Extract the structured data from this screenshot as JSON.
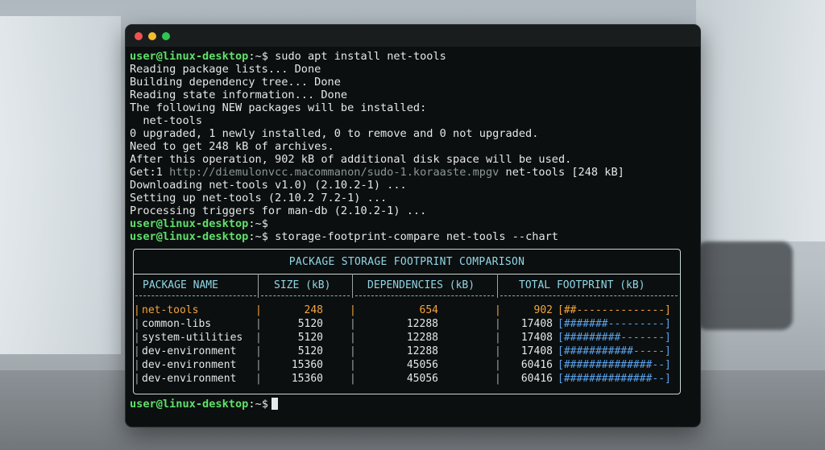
{
  "terminal": {
    "prompt": "user@linux-desktop",
    "path": ":~$",
    "lines": [
      {
        "type": "cmd",
        "text": " sudo apt install net-tools"
      },
      {
        "type": "out",
        "text": "Reading package lists... Done"
      },
      {
        "type": "out",
        "text": "Building dependency tree... Done"
      },
      {
        "type": "out",
        "text": "Reading state information... Done"
      },
      {
        "type": "out",
        "text": "The following NEW packages will be installed:"
      },
      {
        "type": "out",
        "text": "  net-tools"
      },
      {
        "type": "out",
        "text": "0 upgraded, 1 newly installed, 0 to remove and 0 not upgraded."
      },
      {
        "type": "out",
        "text": "Need to get 248 kB of archives."
      },
      {
        "type": "out",
        "text": "After this operation, 902 kB of additional disk space will be used."
      },
      {
        "type": "get",
        "prefix": "Get:1 ",
        "url": "http://diemulonvcc.macommanon/sudo-1.koraaste.mpgv",
        "suffix": " net-tools [248 kB]"
      },
      {
        "type": "out",
        "text": "Downloading net-tools v1.0) (2.10.2-1) ..."
      },
      {
        "type": "out",
        "text": "Setting up net-tools (2.10.2 7.2-1) ..."
      },
      {
        "type": "out",
        "text": "Processing triggers for man-db (2.10.2-1) ..."
      },
      {
        "type": "cmd",
        "text": ""
      },
      {
        "type": "cmd",
        "text": " storage-footprint-compare net-tools --chart"
      }
    ]
  },
  "chart_data": {
    "type": "table",
    "title": "PACKAGE STORAGE FOOTPRINT COMPARISON",
    "columns": [
      "PACKAGE NAME",
      "SIZE (kB)",
      "DEPENDENCIES (kB)",
      "TOTAL FOOTPRINT (kB)"
    ],
    "rows": [
      {
        "name": "net-tools",
        "size": "248",
        "deps": "654",
        "total": "902",
        "bar": "[##--------------]",
        "highlight": true
      },
      {
        "name": "common-libs",
        "size": "5120",
        "deps": "12288",
        "total": "17408",
        "bar": "[#######---------]",
        "highlight": false
      },
      {
        "name": "system-utilities",
        "size": "5120",
        "deps": "12288",
        "total": "17408",
        "bar": "[#########-------]",
        "highlight": false
      },
      {
        "name": "dev-environment",
        "size": "5120",
        "deps": "12288",
        "total": "17408",
        "bar": "[###########-----]",
        "highlight": false
      },
      {
        "name": "dev-environment",
        "size": "15360",
        "deps": "45056",
        "total": "60416",
        "bar": "[##############--]",
        "highlight": false
      },
      {
        "name": "dev-environment",
        "size": "15360",
        "deps": "45056",
        "total": "60416",
        "bar": "[##############--]",
        "highlight": false
      }
    ],
    "colors": {
      "highlight": "#f2a440",
      "bar": "#5aa3ee",
      "header": "#8fd6e6"
    }
  }
}
